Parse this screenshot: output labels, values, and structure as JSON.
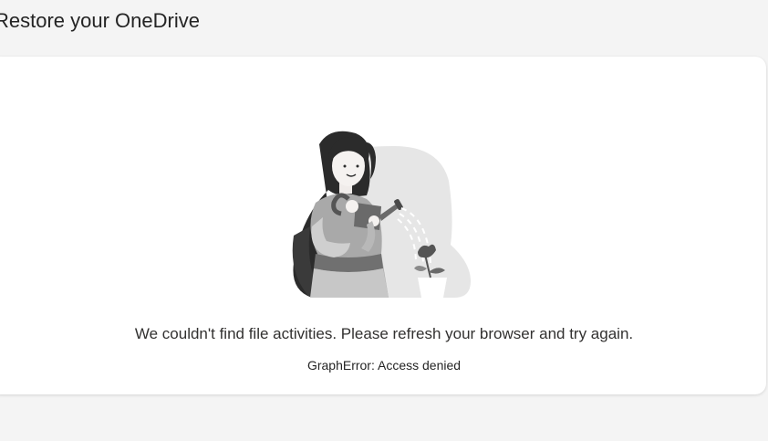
{
  "page": {
    "title": "Restore your OneDrive"
  },
  "empty_state": {
    "illustration": "woman-watering-plant-illustration",
    "message": "We couldn't find file activities. Please refresh your browser and try again.",
    "error_detail": "GraphError: Access denied"
  },
  "colors": {
    "page_background": "#f4f4f4",
    "card_background": "#ffffff",
    "text_primary": "#323130"
  }
}
